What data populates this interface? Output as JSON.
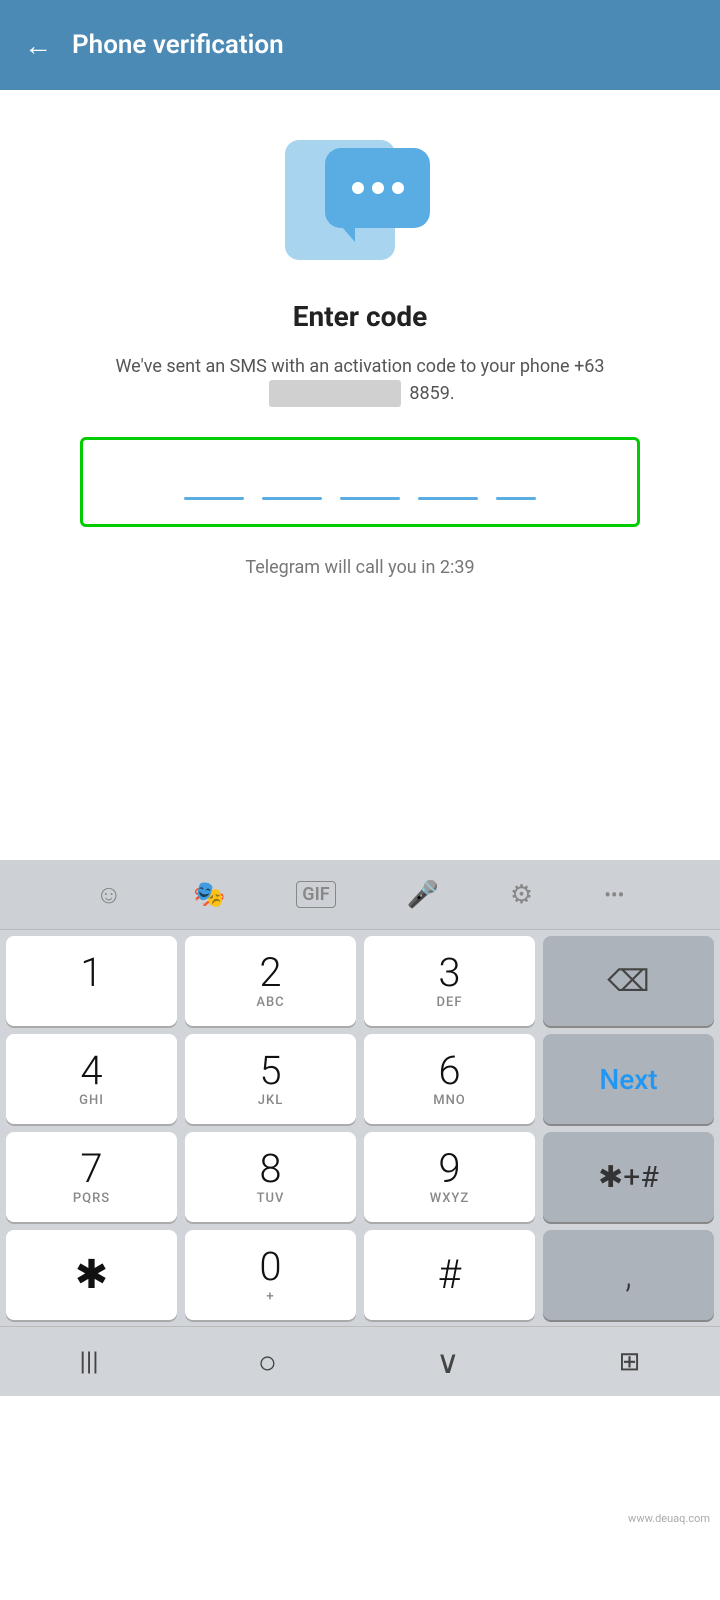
{
  "statusBar": {
    "time": ""
  },
  "header": {
    "backLabel": "←",
    "title": "Phone verification"
  },
  "main": {
    "enterCodeTitle": "Enter code",
    "smsDescriptionPre": "We've sent an SMS with an activation code to your phone ",
    "phonePrefix": "+63",
    "phoneMasked": "██████████",
    "phoneSuffix": " 8859.",
    "timerText": "Telegram will call you in 2:39"
  },
  "keyboard": {
    "topIcons": [
      "😊",
      "🎭",
      "GIF",
      "🎤",
      "⚙",
      "•••"
    ],
    "rows": [
      [
        {
          "main": "1",
          "sub": ""
        },
        {
          "main": "2",
          "sub": "ABC"
        },
        {
          "main": "3",
          "sub": "DEF"
        },
        {
          "main": "⌫",
          "sub": "",
          "type": "backspace"
        }
      ],
      [
        {
          "main": "4",
          "sub": "GHI"
        },
        {
          "main": "5",
          "sub": "JKL"
        },
        {
          "main": "6",
          "sub": "MNO"
        },
        {
          "main": "Next",
          "sub": "",
          "type": "next"
        }
      ],
      [
        {
          "main": "7",
          "sub": "PQRS"
        },
        {
          "main": "8",
          "sub": "TUV"
        },
        {
          "main": "9",
          "sub": "WXYZ"
        },
        {
          "main": "✱+#",
          "sub": "",
          "type": "symbol"
        }
      ],
      [
        {
          "main": "✱",
          "sub": ""
        },
        {
          "main": "0",
          "sub": "+"
        },
        {
          "main": "#",
          "sub": ""
        },
        {
          "main": ",",
          "sub": "",
          "type": "comma"
        }
      ]
    ],
    "navIcons": [
      "|||",
      "○",
      "∨",
      "⊞"
    ]
  }
}
